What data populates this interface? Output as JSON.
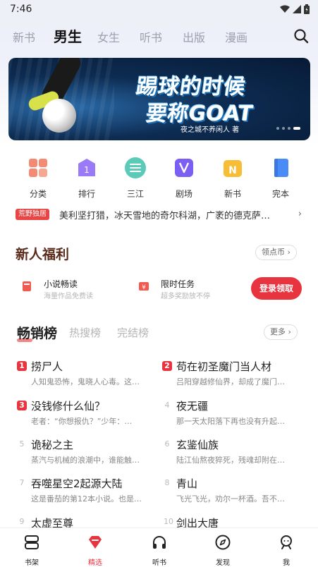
{
  "status": {
    "time": "7:46"
  },
  "top_nav": {
    "tabs": [
      {
        "label": "新书"
      },
      {
        "label": "男生"
      },
      {
        "label": "女生"
      },
      {
        "label": "听书"
      },
      {
        "label": "出版"
      },
      {
        "label": "漫画"
      }
    ],
    "active_tab": "男生"
  },
  "banner": {
    "title_line1": "踢球的时候",
    "title_line2": "要称GOAT",
    "author": "夜之城不养闲人 著"
  },
  "categories": [
    {
      "label": "分类",
      "icon": "grid-icon",
      "color": "#f07e6a"
    },
    {
      "label": "排行",
      "icon": "rank-icon",
      "color": "#8e6cf5"
    },
    {
      "label": "三江",
      "icon": "sanjiang-icon",
      "color": "#4fc7b3"
    },
    {
      "label": "剧场",
      "icon": "theater-icon",
      "color": "#7a5cf0"
    },
    {
      "label": "新书",
      "icon": "new-book-icon",
      "color": "#f5b82e"
    },
    {
      "label": "完本",
      "icon": "finished-book-icon",
      "color": "#4a8cf7"
    }
  ],
  "notice": {
    "badge": "荒野独居",
    "text": "美利坚打猎，冰天雪地的奇尔科湖，广袤的德克萨…"
  },
  "welfare": {
    "title": "新人福利",
    "more_label": "领点币",
    "items": [
      {
        "title": "小说畅读",
        "subtitle": "海量作品免费读"
      },
      {
        "title": "限时任务",
        "subtitle": "超多奖励放不停"
      }
    ],
    "login_label": "登录领取"
  },
  "ranking": {
    "tabs": [
      "畅销榜",
      "热搜榜",
      "完结榜"
    ],
    "more_label": "更多",
    "books": [
      {
        "rank": "1",
        "title": "捞尸人",
        "desc": "人知鬼恐怖，鬼晓人心毒。这…"
      },
      {
        "rank": "2",
        "title": "苟在初圣魔门当人材",
        "desc": "吕阳穿越修仙界，却成了魔门…"
      },
      {
        "rank": "3",
        "title": "没钱修什么仙？",
        "desc": "老者：“你想报仇？”少年：…"
      },
      {
        "rank": "4",
        "title": "夜无疆",
        "desc": "那一天太阳落下再也没有升起…"
      },
      {
        "rank": "5",
        "title": "诡秘之主",
        "desc": "蒸汽与机械的浪潮中，谁能触…"
      },
      {
        "rank": "6",
        "title": "玄鉴仙族",
        "desc": "陆江仙熬夜猝死，残魂却附在…"
      },
      {
        "rank": "7",
        "title": "吞噬星空2起源大陆",
        "desc": "这是番茄的第12本小说。也是…"
      },
      {
        "rank": "8",
        "title": "青山",
        "desc": "飞光飞光，劝尔一杯酒。吾不…"
      },
      {
        "rank": "9",
        "title": "太虚至尊",
        "desc": ""
      },
      {
        "rank": "10",
        "title": "剑出大唐",
        "desc": ""
      }
    ]
  },
  "bottom_nav": [
    {
      "label": "书架",
      "icon": "bookshelf-icon"
    },
    {
      "label": "精选",
      "icon": "featured-icon"
    },
    {
      "label": "听书",
      "icon": "headphones-icon"
    },
    {
      "label": "发现",
      "icon": "compass-icon"
    },
    {
      "label": "我",
      "icon": "profile-icon"
    }
  ],
  "colors": {
    "accent": "#e8343e",
    "brown_title": "#5a2a1a"
  }
}
